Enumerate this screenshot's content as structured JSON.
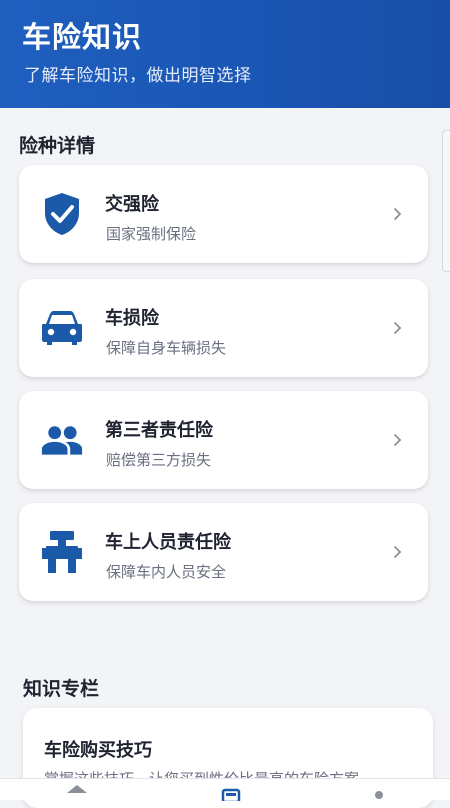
{
  "header": {
    "title": "车险知识",
    "subtitle": "了解车险知识，做出明智选择"
  },
  "sections": {
    "insurance_types_title": "险种详情",
    "knowledge_title": "知识专栏"
  },
  "insurance_items": [
    {
      "title": "交强险",
      "desc": "国家强制保险",
      "icon": "shield-check-icon"
    },
    {
      "title": "车损险",
      "desc": "保障自身车辆损失",
      "icon": "car-icon"
    },
    {
      "title": "第三者责任险",
      "desc": "赔偿第三方损失",
      "icon": "people-icon"
    },
    {
      "title": "车上人员责任险",
      "desc": "保障车内人员安全",
      "icon": "seat-icon"
    }
  ],
  "knowledge_items": [
    {
      "title": "车险购买技巧",
      "desc": "掌握这些技巧，让您买到性价比最高的车险方案"
    }
  ],
  "colors": {
    "brand_blue": "#1f5fbf",
    "icon_blue": "#1a5aa8"
  },
  "bottom_nav": [
    "home-icon",
    "policy-icon",
    "profile-icon"
  ]
}
